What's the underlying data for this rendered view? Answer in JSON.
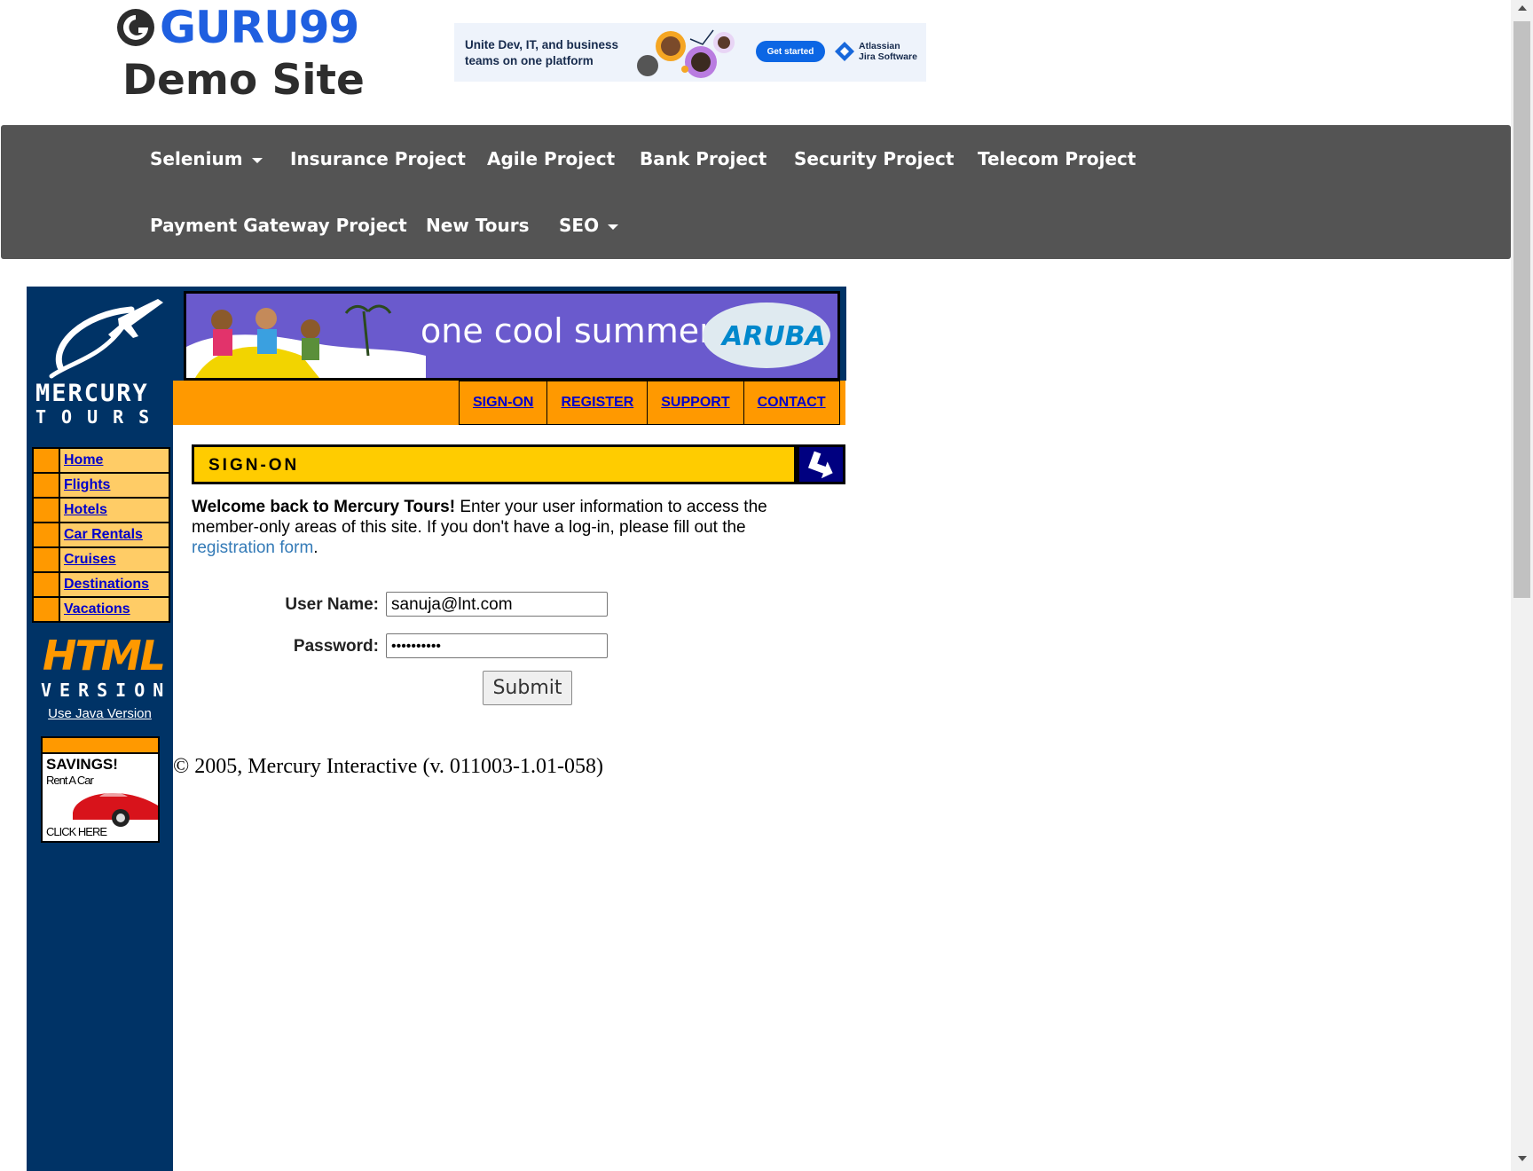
{
  "header": {
    "brand": "GURU99",
    "subtitle": "Demo Site"
  },
  "ad": {
    "text": "Unite Dev, IT, and business teams on one platform",
    "button": "Get started",
    "vendor_line1": "Atlassian",
    "vendor_line2": "Jira Software"
  },
  "nav": {
    "items": [
      {
        "label": "Selenium",
        "dropdown": true
      },
      {
        "label": "Insurance Project"
      },
      {
        "label": "Agile Project"
      },
      {
        "label": "Bank Project"
      },
      {
        "label": "Security Project"
      },
      {
        "label": "Telecom Project"
      },
      {
        "label": "Payment Gateway Project"
      },
      {
        "label": "New Tours"
      },
      {
        "label": "SEO",
        "dropdown": true
      }
    ]
  },
  "mercury": {
    "logo_line1": "MERCURY",
    "logo_line2": "TOURS",
    "banner_text": "one cool summer",
    "banner_brand": "ARUBA",
    "top_links": [
      "SIGN-ON",
      "REGISTER",
      "SUPPORT",
      "CONTACT"
    ],
    "side_menu": [
      "Home",
      "Flights",
      "Hotels",
      "Car Rentals",
      "Cruises",
      "Destinations",
      "Vacations"
    ],
    "html_version_line1": "HTML",
    "html_version_line2": "VERSION",
    "java_link": "Use Java Version",
    "savings_title": "SAVINGS!",
    "savings_sub": "Rent A Car",
    "savings_cta": "CLICK HERE",
    "signon_heading": "SIGN-ON",
    "welcome_bold": "Welcome back to Mercury Tours!",
    "welcome_text": " Enter your user information to access the member-only areas of this site. If you don't have a log-in, please fill out the ",
    "welcome_link": "registration form",
    "welcome_end": ".",
    "form": {
      "username_label": "User Name:",
      "username_value": "sanuja@lnt.com",
      "password_label": "Password:",
      "password_value": "••••••••••",
      "submit_label": "Submit"
    },
    "copyright": "© 2005, Mercury Interactive (v. 011003-1.01-058)"
  },
  "colors": {
    "nav_bg": "#545454",
    "brand_blue": "#1f5fe0",
    "mercury_navy": "#003366",
    "mercury_orange": "#ff9900",
    "mercury_yellow": "#ffcc00"
  }
}
